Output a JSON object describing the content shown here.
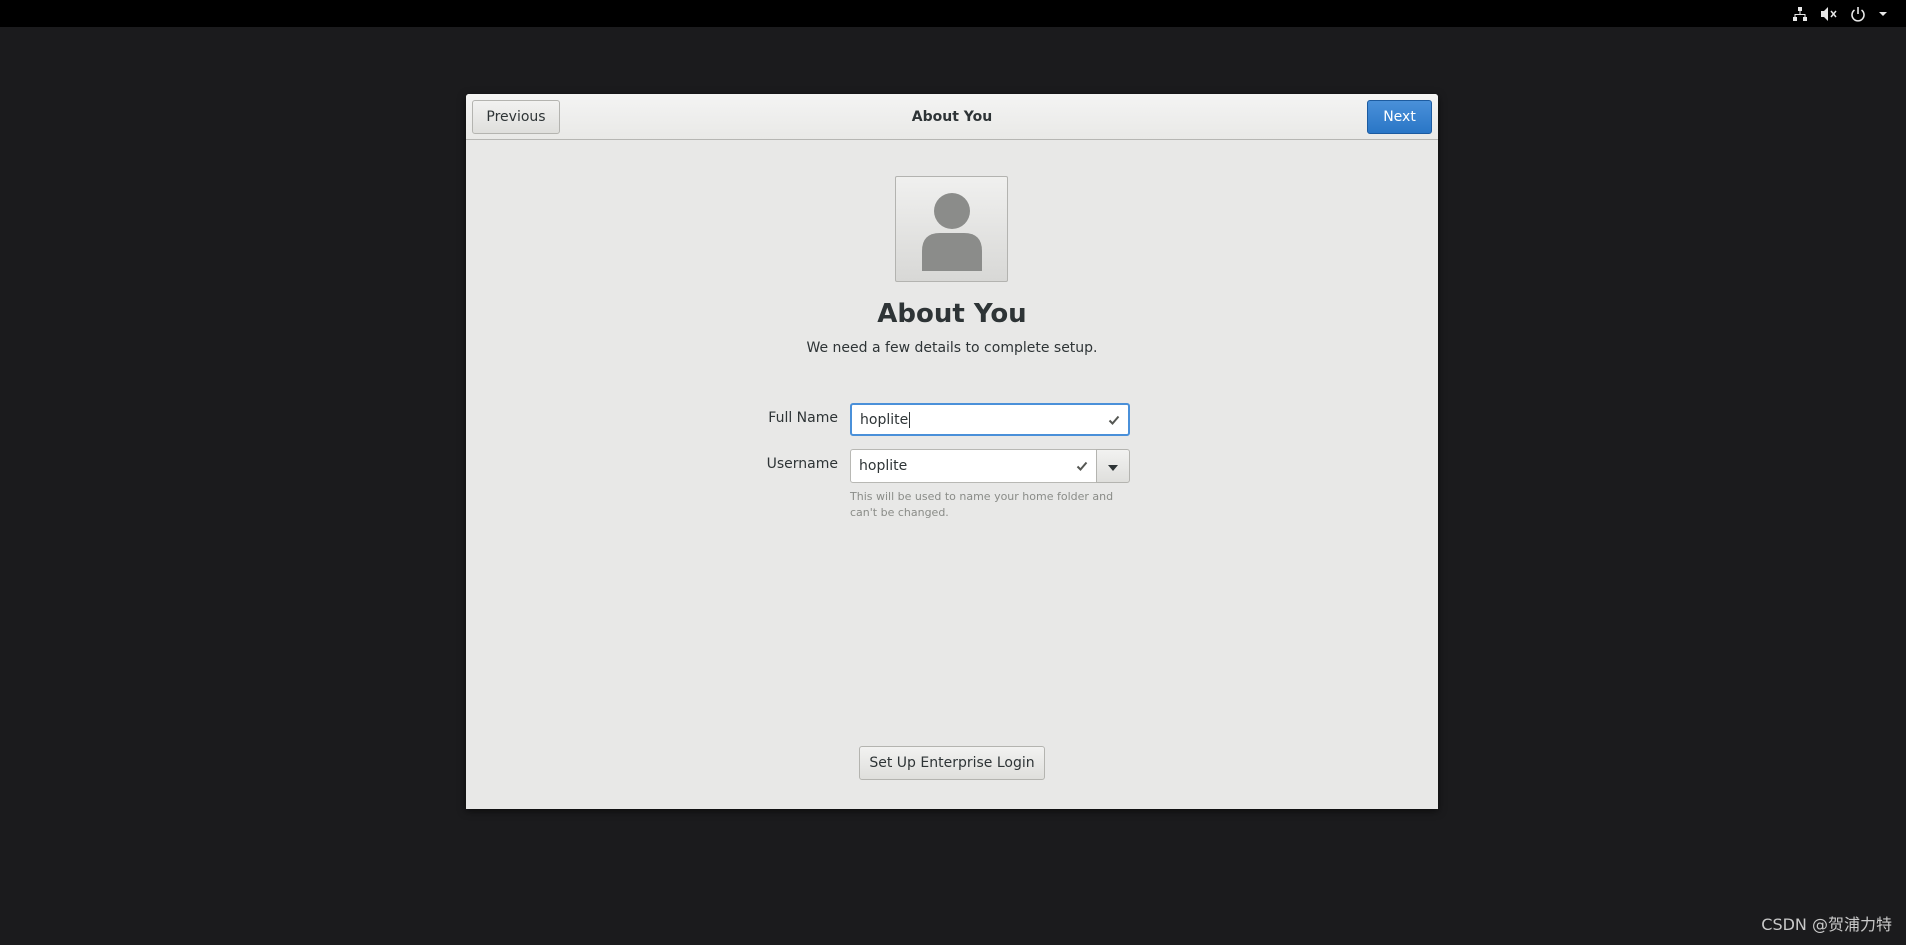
{
  "window": {
    "title": "About You",
    "previous_label": "Previous",
    "next_label": "Next"
  },
  "page": {
    "heading": "About You",
    "subtitle": "We need a few details to complete setup."
  },
  "form": {
    "fullname_label": "Full Name",
    "fullname_value": "hoplite",
    "username_label": "Username",
    "username_value": "hoplite",
    "username_hint": "This will be used to name your home folder and can't be changed."
  },
  "enterprise_label": "Set Up Enterprise Login",
  "watermark": "CSDN @贺浦力特",
  "tray_icons": [
    "network-wired-icon",
    "audio-muted-icon",
    "power-icon",
    "chevron-down-icon"
  ],
  "colors": {
    "accent": "#4a90d9",
    "desktop": "#1b1b1d",
    "topbar": "#000000",
    "window_bg": "#e8e8e7"
  }
}
